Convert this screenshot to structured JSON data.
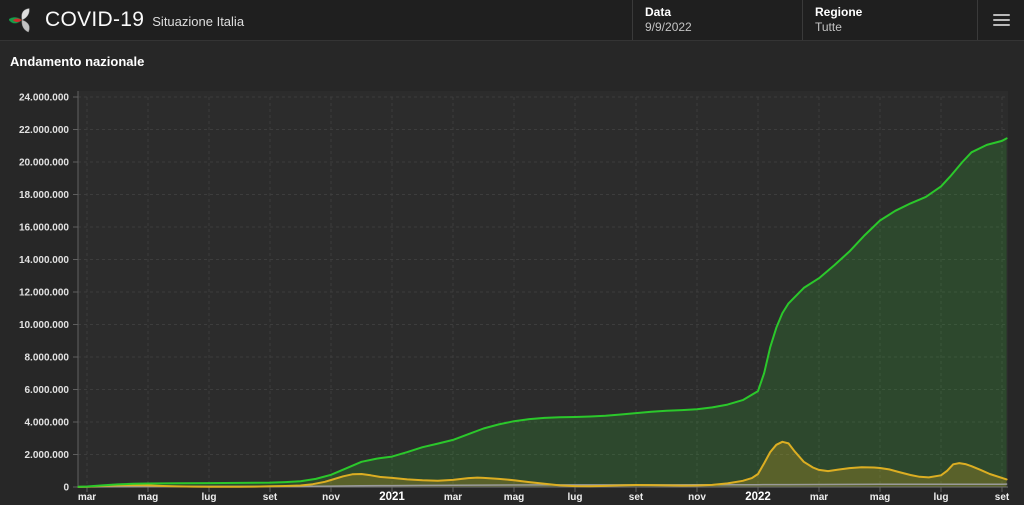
{
  "header": {
    "logo_icon": "protezione-civile-logo",
    "app_title": "COVID-19",
    "app_subtitle": "Situazione Italia",
    "date": {
      "label": "Data",
      "value": "9/9/2022"
    },
    "region": {
      "label": "Regione",
      "value": "Tutte"
    },
    "menu_icon": "hamburger-menu-icon"
  },
  "main": {
    "section_title": "Andamento nazionale"
  },
  "chart_data": {
    "type": "area",
    "title": "Andamento nazionale",
    "x_tick_labels": [
      "mar",
      "mag",
      "lug",
      "set",
      "nov",
      "2021",
      "mar",
      "mag",
      "lug",
      "set",
      "nov",
      "2022",
      "mar",
      "mag",
      "lug",
      "set"
    ],
    "x_tick_is_year": [
      false,
      false,
      false,
      false,
      false,
      true,
      false,
      false,
      false,
      false,
      false,
      true,
      false,
      false,
      false,
      false
    ],
    "x_axis_note": "one tick every 2 months, from mar 2020 to set 2022; series values sampled monthly (unit = months after mar 2020 tick)",
    "ylim": [
      0,
      24000000
    ],
    "y_tick_step": 2000000,
    "grid": "dashed",
    "legend": "none",
    "units_of_values": "millions",
    "series": [
      {
        "name": "green_series",
        "color": "#2bc82b",
        "fill": "rgba(50,200,50,0.18)",
        "points": [
          [
            -0.28,
            0.01
          ],
          [
            0,
            0.03
          ],
          [
            0.5,
            0.1
          ],
          [
            1,
            0.16
          ],
          [
            1.5,
            0.2
          ],
          [
            2,
            0.215
          ],
          [
            3,
            0.233
          ],
          [
            4,
            0.241
          ],
          [
            5,
            0.252
          ],
          [
            6,
            0.272
          ],
          [
            6.5,
            0.3
          ],
          [
            7,
            0.35
          ],
          [
            7.5,
            0.5
          ],
          [
            8,
            0.75
          ],
          [
            8.5,
            1.15
          ],
          [
            9,
            1.55
          ],
          [
            9.5,
            1.75
          ],
          [
            10,
            1.87
          ],
          [
            10.5,
            2.15
          ],
          [
            11,
            2.45
          ],
          [
            11.5,
            2.67
          ],
          [
            12,
            2.9
          ],
          [
            12.5,
            3.25
          ],
          [
            13,
            3.6
          ],
          [
            13.5,
            3.85
          ],
          [
            14,
            4.05
          ],
          [
            14.5,
            4.18
          ],
          [
            15,
            4.25
          ],
          [
            15.5,
            4.29
          ],
          [
            16,
            4.31
          ],
          [
            16.5,
            4.34
          ],
          [
            17,
            4.38
          ],
          [
            17.5,
            4.46
          ],
          [
            18,
            4.55
          ],
          [
            18.5,
            4.63
          ],
          [
            19,
            4.69
          ],
          [
            19.5,
            4.73
          ],
          [
            20,
            4.78
          ],
          [
            20.5,
            4.9
          ],
          [
            21,
            5.07
          ],
          [
            21.5,
            5.35
          ],
          [
            22,
            5.9
          ],
          [
            22.2,
            7.0
          ],
          [
            22.4,
            8.6
          ],
          [
            22.6,
            9.8
          ],
          [
            22.8,
            10.7
          ],
          [
            23,
            11.3
          ],
          [
            23.5,
            12.25
          ],
          [
            24,
            12.85
          ],
          [
            24.5,
            13.65
          ],
          [
            25,
            14.5
          ],
          [
            25.5,
            15.5
          ],
          [
            26,
            16.4
          ],
          [
            26.5,
            17.0
          ],
          [
            27,
            17.45
          ],
          [
            27.5,
            17.85
          ],
          [
            28,
            18.5
          ],
          [
            28.3,
            19.1
          ],
          [
            28.7,
            20.0
          ],
          [
            29,
            20.6
          ],
          [
            29.5,
            21.05
          ],
          [
            30,
            21.3
          ],
          [
            30.15,
            21.45
          ]
        ]
      },
      {
        "name": "yellow_series",
        "color": "#dcae22",
        "fill": "rgba(224,170,34,0.25)",
        "points": [
          [
            -0.28,
            0.005
          ],
          [
            0,
            0.02
          ],
          [
            0.5,
            0.07
          ],
          [
            1,
            0.1
          ],
          [
            1.3,
            0.108
          ],
          [
            1.7,
            0.104
          ],
          [
            2,
            0.098
          ],
          [
            2.5,
            0.06
          ],
          [
            3,
            0.039
          ],
          [
            3.5,
            0.022
          ],
          [
            4,
            0.015
          ],
          [
            4.5,
            0.013
          ],
          [
            5,
            0.015
          ],
          [
            5.5,
            0.022
          ],
          [
            6,
            0.042
          ],
          [
            6.5,
            0.062
          ],
          [
            7,
            0.095
          ],
          [
            7.4,
            0.17
          ],
          [
            7.8,
            0.32
          ],
          [
            8,
            0.43
          ],
          [
            8.4,
            0.66
          ],
          [
            8.7,
            0.78
          ],
          [
            9,
            0.8
          ],
          [
            9.3,
            0.72
          ],
          [
            9.6,
            0.62
          ],
          [
            10,
            0.56
          ],
          [
            10.5,
            0.47
          ],
          [
            11,
            0.41
          ],
          [
            11.5,
            0.39
          ],
          [
            12,
            0.44
          ],
          [
            12.5,
            0.55
          ],
          [
            12.8,
            0.58
          ],
          [
            13,
            0.56
          ],
          [
            13.5,
            0.5
          ],
          [
            14,
            0.42
          ],
          [
            14.5,
            0.3
          ],
          [
            15,
            0.2
          ],
          [
            15.5,
            0.1
          ],
          [
            16,
            0.056
          ],
          [
            16.5,
            0.048
          ],
          [
            17,
            0.07
          ],
          [
            17.5,
            0.1
          ],
          [
            18,
            0.126
          ],
          [
            18.5,
            0.116
          ],
          [
            19,
            0.096
          ],
          [
            19.5,
            0.086
          ],
          [
            20,
            0.09
          ],
          [
            20.5,
            0.13
          ],
          [
            21,
            0.22
          ],
          [
            21.5,
            0.38
          ],
          [
            21.8,
            0.55
          ],
          [
            22,
            0.8
          ],
          [
            22.2,
            1.45
          ],
          [
            22.4,
            2.15
          ],
          [
            22.6,
            2.6
          ],
          [
            22.8,
            2.78
          ],
          [
            23,
            2.68
          ],
          [
            23.2,
            2.2
          ],
          [
            23.5,
            1.55
          ],
          [
            23.8,
            1.2
          ],
          [
            24,
            1.05
          ],
          [
            24.3,
            0.98
          ],
          [
            24.6,
            1.06
          ],
          [
            25,
            1.16
          ],
          [
            25.4,
            1.21
          ],
          [
            25.8,
            1.2
          ],
          [
            26,
            1.17
          ],
          [
            26.3,
            1.08
          ],
          [
            26.6,
            0.93
          ],
          [
            27,
            0.74
          ],
          [
            27.3,
            0.63
          ],
          [
            27.6,
            0.59
          ],
          [
            28,
            0.72
          ],
          [
            28.2,
            1.0
          ],
          [
            28.4,
            1.4
          ],
          [
            28.6,
            1.47
          ],
          [
            28.8,
            1.41
          ],
          [
            29,
            1.28
          ],
          [
            29.3,
            1.05
          ],
          [
            29.6,
            0.8
          ],
          [
            30,
            0.56
          ],
          [
            30.15,
            0.47
          ]
        ]
      },
      {
        "name": "gray_series",
        "color": "#9a9a9a",
        "fill": null,
        "points": [
          [
            -0.28,
            0.0
          ],
          [
            0,
            0.006
          ],
          [
            1,
            0.022
          ],
          [
            2,
            0.031
          ],
          [
            3,
            0.034
          ],
          [
            4,
            0.035
          ],
          [
            5,
            0.035
          ],
          [
            6,
            0.036
          ],
          [
            7,
            0.04
          ],
          [
            8,
            0.053
          ],
          [
            9,
            0.072
          ],
          [
            10,
            0.086
          ],
          [
            11,
            0.098
          ],
          [
            12,
            0.107
          ],
          [
            13,
            0.116
          ],
          [
            14,
            0.123
          ],
          [
            15,
            0.127
          ],
          [
            16,
            0.128
          ],
          [
            17,
            0.129
          ],
          [
            18,
            0.131
          ],
          [
            19,
            0.132
          ],
          [
            20,
            0.133
          ],
          [
            21,
            0.136
          ],
          [
            22,
            0.142
          ],
          [
            23,
            0.149
          ],
          [
            24,
            0.156
          ],
          [
            25,
            0.161
          ],
          [
            26,
            0.165
          ],
          [
            27,
            0.168
          ],
          [
            28,
            0.17
          ],
          [
            29,
            0.173
          ],
          [
            30,
            0.175
          ],
          [
            30.15,
            0.176
          ]
        ]
      }
    ]
  }
}
